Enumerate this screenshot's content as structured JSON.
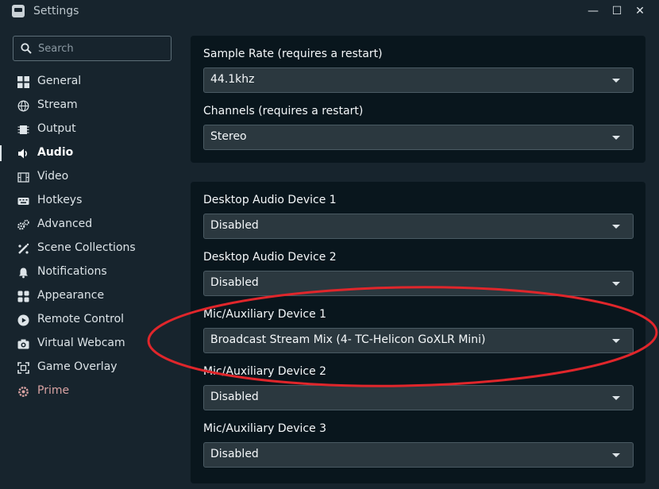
{
  "window": {
    "title": "Settings",
    "minimize_glyph": "—",
    "maximize_glyph": "☐",
    "close_glyph": "✕"
  },
  "search": {
    "placeholder": "Search",
    "value": ""
  },
  "sidebar": {
    "items": [
      {
        "label": "General",
        "icon": "grid-icon"
      },
      {
        "label": "Stream",
        "icon": "globe-icon"
      },
      {
        "label": "Output",
        "icon": "chip-icon"
      },
      {
        "label": "Audio",
        "icon": "speaker-icon",
        "active": true
      },
      {
        "label": "Video",
        "icon": "film-icon"
      },
      {
        "label": "Hotkeys",
        "icon": "keyboard-icon"
      },
      {
        "label": "Advanced",
        "icon": "gears-icon"
      },
      {
        "label": "Scene Collections",
        "icon": "collection-icon"
      },
      {
        "label": "Notifications",
        "icon": "bell-icon"
      },
      {
        "label": "Appearance",
        "icon": "palette-icon"
      },
      {
        "label": "Remote Control",
        "icon": "play-circle-icon"
      },
      {
        "label": "Virtual Webcam",
        "icon": "camera-icon"
      },
      {
        "label": "Game Overlay",
        "icon": "expand-icon"
      },
      {
        "label": "Prime",
        "icon": "prime-icon"
      }
    ]
  },
  "general_panel": {
    "sample_rate": {
      "label": "Sample Rate (requires a restart)",
      "value": "44.1khz"
    },
    "channels": {
      "label": "Channels (requires a restart)",
      "value": "Stereo"
    }
  },
  "devices_panel": {
    "desktop1": {
      "label": "Desktop Audio Device 1",
      "value": "Disabled"
    },
    "desktop2": {
      "label": "Desktop Audio Device 2",
      "value": "Disabled"
    },
    "mic1": {
      "label": "Mic/Auxiliary Device 1",
      "value": "Broadcast Stream Mix (4- TC-Helicon GoXLR Mini)"
    },
    "mic2": {
      "label": "Mic/Auxiliary Device 2",
      "value": "Disabled"
    },
    "mic3": {
      "label": "Mic/Auxiliary Device 3",
      "value": "Disabled"
    }
  },
  "colors": {
    "background": "#17242d",
    "panel": "#09161d",
    "select": "#2b383f",
    "annotation": "#e0262b",
    "prime": "#d9a3a3"
  }
}
